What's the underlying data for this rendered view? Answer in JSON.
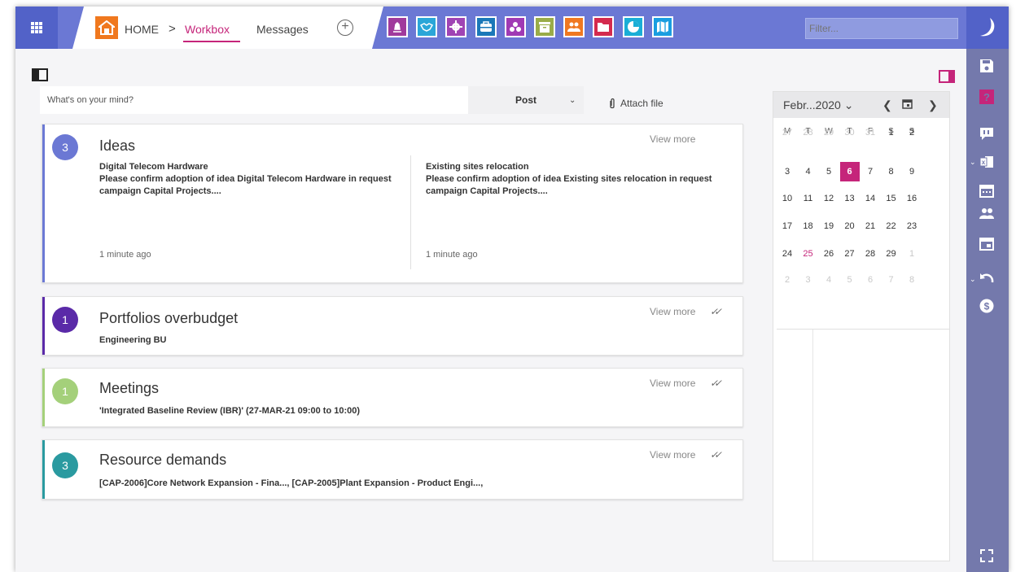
{
  "header": {
    "home_label": "HOME",
    "separator": ">",
    "tabs": [
      {
        "label": "Workbox",
        "active": true
      },
      {
        "label": "Messages",
        "active": false
      }
    ],
    "add_tab_symbol": "+",
    "modules": [
      {
        "name": "strategy-icon",
        "color": "#a03a9c"
      },
      {
        "name": "handshake-icon",
        "color": "#2aa6d8"
      },
      {
        "name": "settings-icon",
        "color": "#a044b4"
      },
      {
        "name": "briefcase-icon",
        "color": "#1b78b8"
      },
      {
        "name": "resources-icon",
        "color": "#a03ab4"
      },
      {
        "name": "archive-icon",
        "color": "#9aac48"
      },
      {
        "name": "team-icon",
        "color": "#f07820"
      },
      {
        "name": "folder-icon",
        "color": "#d42a4e"
      },
      {
        "name": "pie-chart-icon",
        "color": "#1aaed6"
      },
      {
        "name": "map-icon",
        "color": "#1a9ee0"
      }
    ],
    "filter_placeholder": "Filter..."
  },
  "post": {
    "placeholder": "What's on your mind?",
    "button_label": "Post",
    "attach_label": "Attach file"
  },
  "cards": {
    "ideas": {
      "count": "3",
      "title": "Ideas",
      "view_more": "View more",
      "accent": "#6b78d4",
      "items": [
        {
          "heading": "Digital Telecom Hardware",
          "text": "Please confirm adoption of idea Digital Telecom Hardware in request campaign Capital Projects....",
          "time": "1 minute ago"
        },
        {
          "heading": "Existing sites relocation",
          "text": "Please confirm adoption of idea Existing sites relocation in request campaign Capital Projects....",
          "time": "1 minute ago"
        }
      ]
    },
    "portfolios": {
      "count": "1",
      "title": "Portfolios overbudget",
      "view_more": "View more",
      "sub": "Engineering BU",
      "accent": "#5a2aa8"
    },
    "meetings": {
      "count": "1",
      "title": "Meetings",
      "view_more": "View more",
      "sub": "'Integrated Baseline Review (IBR)' (27-MAR-21 09:00 to 10:00)",
      "accent": "#a4d07a"
    },
    "resources": {
      "count": "3",
      "title": "Resource demands",
      "view_more": "View more",
      "sub": "[CAP-2006]Core Network Expansion - Fina...,  [CAP-2005]Plant Expansion - Product Engi...,",
      "accent": "#2a9aa0"
    }
  },
  "calendar": {
    "title": "Febr...2020",
    "weekdays": [
      "M",
      "T",
      "W",
      "T",
      "F",
      "S",
      "S"
    ],
    "weeks": [
      [
        [
          "27",
          "dim"
        ],
        [
          "28",
          "dim"
        ],
        [
          "29",
          "dim"
        ],
        [
          "30",
          "dim"
        ],
        [
          "31",
          "dim"
        ],
        [
          "1",
          ""
        ],
        [
          "2",
          ""
        ]
      ],
      [
        [
          "3",
          ""
        ],
        [
          "4",
          ""
        ],
        [
          "5",
          ""
        ],
        [
          "6",
          "sel"
        ],
        [
          "7",
          ""
        ],
        [
          "8",
          ""
        ],
        [
          "9",
          ""
        ]
      ],
      [
        [
          "10",
          ""
        ],
        [
          "11",
          ""
        ],
        [
          "12",
          ""
        ],
        [
          "13",
          ""
        ],
        [
          "14",
          ""
        ],
        [
          "15",
          ""
        ],
        [
          "16",
          ""
        ]
      ],
      [
        [
          "17",
          ""
        ],
        [
          "18",
          ""
        ],
        [
          "19",
          ""
        ],
        [
          "20",
          ""
        ],
        [
          "21",
          ""
        ],
        [
          "22",
          ""
        ],
        [
          "23",
          ""
        ]
      ],
      [
        [
          "24",
          ""
        ],
        [
          "25",
          "red"
        ],
        [
          "26",
          ""
        ],
        [
          "27",
          ""
        ],
        [
          "28",
          ""
        ],
        [
          "29",
          ""
        ],
        [
          "1",
          "dim"
        ]
      ],
      [
        [
          "2",
          "dim"
        ],
        [
          "3",
          "dim"
        ],
        [
          "4",
          "dim"
        ],
        [
          "5",
          "dim"
        ],
        [
          "6",
          "dim"
        ],
        [
          "7",
          "dim"
        ],
        [
          "8",
          "dim"
        ]
      ]
    ]
  },
  "rail": {
    "icons": [
      "save-icon",
      "help-icon",
      "comments-icon",
      "excel-icon",
      "calendar-grid-icon",
      "users-icon",
      "calendar-icon",
      "undo-icon",
      "dollar-icon",
      "fullscreen-icon"
    ]
  }
}
